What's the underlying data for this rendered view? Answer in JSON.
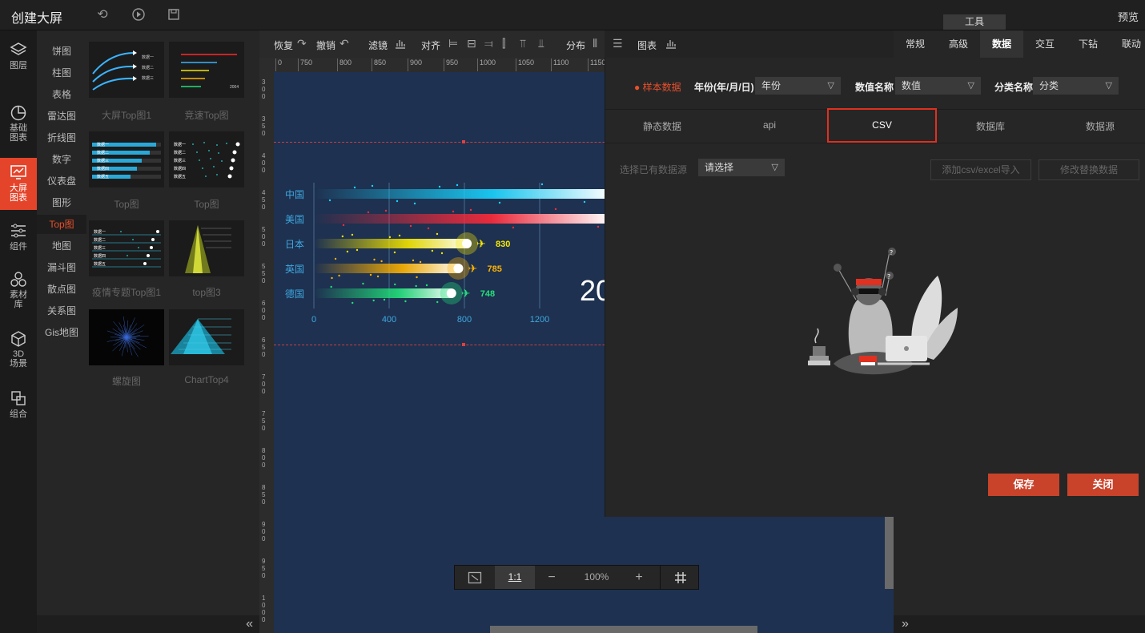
{
  "header": {
    "title": "创建大屏",
    "preview": "预览",
    "tool_tab": "工具"
  },
  "left_rail": [
    {
      "name": "layers",
      "label": "图层",
      "icon": "layers-icon"
    },
    {
      "name": "basic-chart",
      "label": "基础图表",
      "icon": "pie-chart-icon"
    },
    {
      "name": "big-screen-chart",
      "label": "大屏图表",
      "icon": "screen-chart-icon",
      "active": true
    },
    {
      "name": "components",
      "label": "组件",
      "icon": "sliders-icon"
    },
    {
      "name": "assets",
      "label": "素材库",
      "icon": "assets-icon"
    },
    {
      "name": "3d-scene",
      "label": "3D场景",
      "icon": "cube-icon"
    },
    {
      "name": "group",
      "label": "组合",
      "icon": "group-icon"
    }
  ],
  "categories": [
    "饼图",
    "柱图",
    "表格",
    "雷达图",
    "折线图",
    "数字",
    "仪表盘",
    "图形",
    "Top图",
    "地图",
    "漏斗图",
    "散点图",
    "关系图",
    "Gis地图"
  ],
  "active_category": "Top图",
  "thumbnails": [
    {
      "label": "大屏Top图1"
    },
    {
      "label": "竞速Top图"
    },
    {
      "label": "Top图"
    },
    {
      "label": "Top图"
    },
    {
      "label": "疫情专题Top图1"
    },
    {
      "label": "top图3"
    },
    {
      "label": "螺旋图"
    },
    {
      "label": "ChartTop4"
    }
  ],
  "thumb_text": {
    "t1": [
      "数据一",
      "数据二",
      "数据三"
    ],
    "t2_year": "2004",
    "t3": [
      "数据一",
      "数据二",
      "数据三",
      "数据四",
      "数据五"
    ],
    "t4": [
      "数据一",
      "数据二",
      "数据三",
      "数据四",
      "数据五"
    ],
    "t5": [
      "数据一",
      "数据二",
      "数据三",
      "数据四",
      "数据五"
    ]
  },
  "toolbar": {
    "redo": "恢复",
    "undo": "撤销",
    "filter": "滤镜",
    "align": "对齐",
    "distribute": "分布",
    "chart": "图表"
  },
  "ruler_top": [
    "0",
    "750",
    "800",
    "850",
    "900",
    "950",
    "1000",
    "1050",
    "1100",
    "1150"
  ],
  "ruler_left": [
    "300",
    "350",
    "400",
    "450",
    "500",
    "550",
    "600",
    "650",
    "700",
    "750",
    "800",
    "850",
    "900",
    "950",
    "1000"
  ],
  "right_tabs": [
    "常规",
    "高级",
    "数据",
    "交互",
    "下钻",
    "联动"
  ],
  "active_right_tab": "数据",
  "data_panel": {
    "sample_data": "样本数据",
    "year_label": "年份(年/月/日)",
    "year_value": "年份",
    "value_label": "数值名称",
    "value_value": "数值",
    "category_label": "分类名称",
    "category_value": "分类",
    "source_tabs": [
      "静态数据",
      "api",
      "CSV",
      "数据库",
      "数据源"
    ],
    "active_source_tab": "CSV",
    "select_source_label": "选择已有数据源",
    "select_placeholder": "请选择",
    "import_button": "添加csv/excel导入",
    "replace_button": "修改替换数据",
    "save_button": "保存",
    "close_button": "关闭"
  },
  "zoom": {
    "one_to_one": "1:1",
    "minus": "−",
    "value": "100%",
    "plus": "+"
  },
  "canvas_text": {
    "year_fragment": "20"
  },
  "chart_data": {
    "type": "bar",
    "orientation": "horizontal",
    "categories": [
      "中国",
      "美国",
      "日本",
      "英国",
      "德国"
    ],
    "values": [
      null,
      null,
      830,
      785,
      748
    ],
    "value_labels": [
      "",
      "",
      "830",
      "785",
      "748"
    ],
    "x_ticks": [
      "0",
      "400",
      "800",
      "1200"
    ],
    "xlim": [
      0,
      1200
    ],
    "colors": [
      "#19d4ff",
      "#ff2a3a",
      "#f5e600",
      "#ffb300",
      "#22e07a"
    ]
  }
}
